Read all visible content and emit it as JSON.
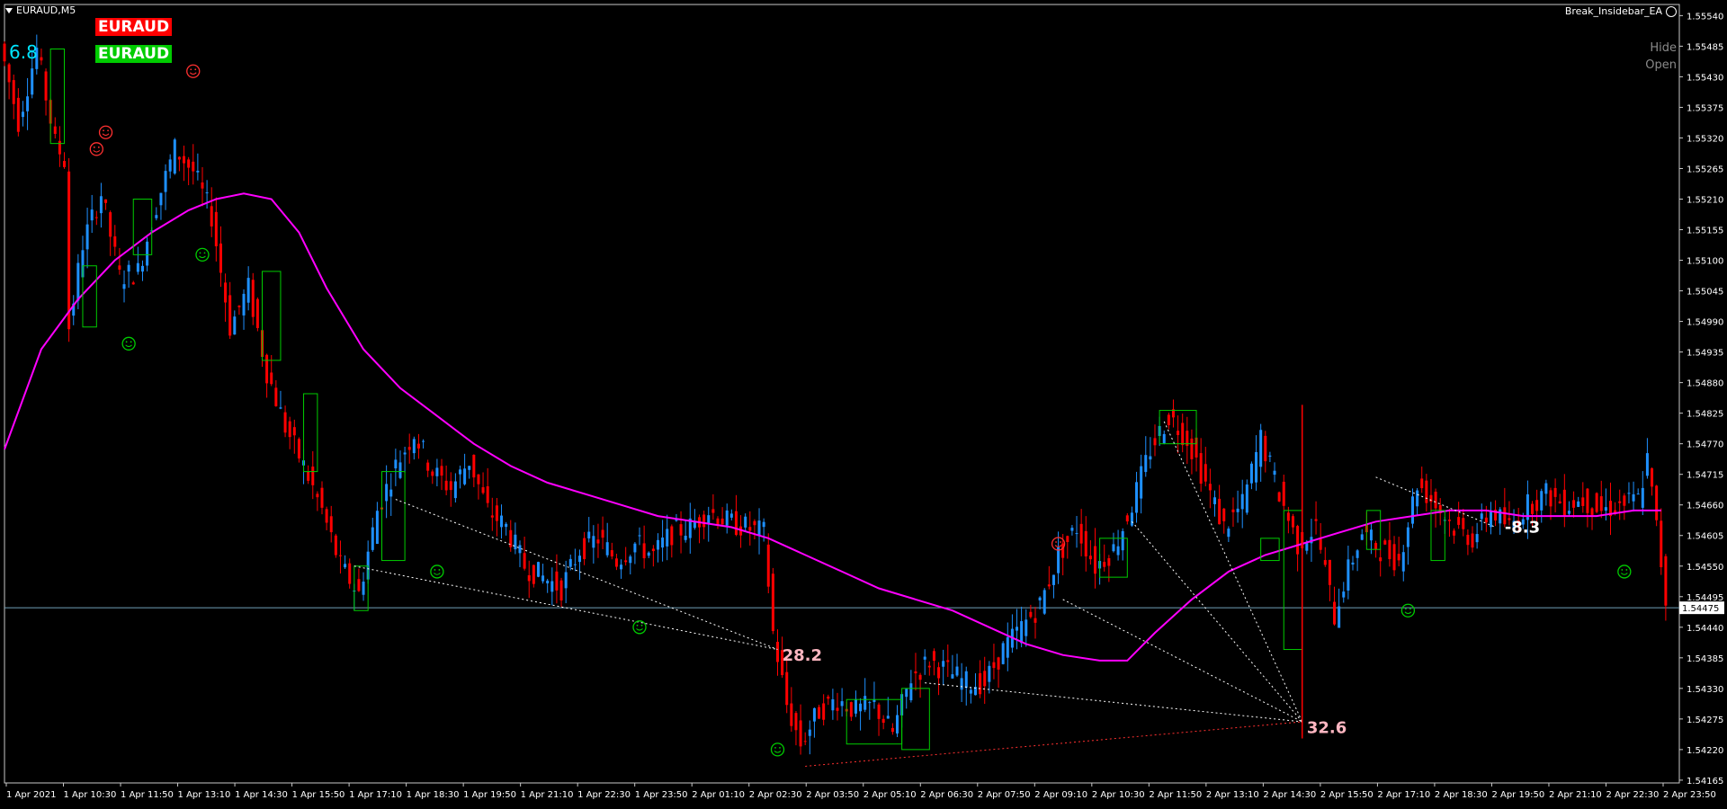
{
  "window": {
    "title": "EURAUD,M5",
    "ea_name": "Break_Insidebar_EA",
    "ea_icon": "smiley-icon"
  },
  "badges": {
    "sell_symbol": "EURAUD",
    "buy_symbol": "EURAUD",
    "sell_color": "#ff0000",
    "buy_color": "#00cc00"
  },
  "score_value": "6.8",
  "panel_buttons": {
    "hide": "Hide",
    "open": "Open"
  },
  "chart_data": {
    "type": "candlestick",
    "symbol": "EURAUD",
    "timeframe": "M5",
    "ylim": [
      1.5416,
      1.5556
    ],
    "y_ticks": [
      "1.55540",
      "1.55485",
      "1.55430",
      "1.55375",
      "1.55320",
      "1.55265",
      "1.55210",
      "1.55155",
      "1.55100",
      "1.55045",
      "1.54990",
      "1.54935",
      "1.54880",
      "1.54825",
      "1.54770",
      "1.54715",
      "1.54660",
      "1.54605",
      "1.54550",
      "1.54495",
      "1.54440",
      "1.54385",
      "1.54330",
      "1.54275",
      "1.54220",
      "1.54165"
    ],
    "x_ticks": [
      "1 Apr 2021",
      "1 Apr 10:30",
      "1 Apr 11:50",
      "1 Apr 13:10",
      "1 Apr 14:30",
      "1 Apr 15:50",
      "1 Apr 17:10",
      "1 Apr 18:30",
      "1 Apr 19:50",
      "1 Apr 21:10",
      "1 Apr 22:30",
      "1 Apr 23:50",
      "2 Apr 01:10",
      "2 Apr 02:30",
      "2 Apr 03:50",
      "2 Apr 05:10",
      "2 Apr 06:30",
      "2 Apr 07:50",
      "2 Apr 09:10",
      "2 Apr 10:30",
      "2 Apr 11:50",
      "2 Apr 13:10",
      "2 Apr 14:30",
      "2 Apr 15:50",
      "2 Apr 17:10",
      "2 Apr 18:30",
      "2 Apr 19:50",
      "2 Apr 21:10",
      "2 Apr 22:30",
      "2 Apr 23:50"
    ],
    "current_price": "1.54475",
    "price_path": [
      [
        0,
        1.5549
      ],
      [
        4,
        1.5535
      ],
      [
        8,
        1.5548
      ],
      [
        12,
        1.5531
      ],
      [
        14,
        1.5528
      ],
      [
        15,
        1.5498
      ],
      [
        18,
        1.5513
      ],
      [
        22,
        1.5522
      ],
      [
        26,
        1.5507
      ],
      [
        30,
        1.5508
      ],
      [
        34,
        1.552
      ],
      [
        38,
        1.553
      ],
      [
        42,
        1.5526
      ],
      [
        46,
        1.5518
      ],
      [
        50,
        1.5498
      ],
      [
        54,
        1.5505
      ],
      [
        58,
        1.549
      ],
      [
        62,
        1.548
      ],
      [
        66,
        1.5473
      ],
      [
        70,
        1.5465
      ],
      [
        74,
        1.5455
      ],
      [
        78,
        1.545
      ],
      [
        82,
        1.5465
      ],
      [
        86,
        1.5473
      ],
      [
        90,
        1.5479
      ],
      [
        94,
        1.5472
      ],
      [
        98,
        1.5469
      ],
      [
        102,
        1.5474
      ],
      [
        106,
        1.5465
      ],
      [
        110,
        1.5462
      ],
      [
        114,
        1.5455
      ],
      [
        118,
        1.5453
      ],
      [
        122,
        1.5451
      ],
      [
        126,
        1.5458
      ],
      [
        130,
        1.546
      ],
      [
        134,
        1.5456
      ],
      [
        138,
        1.5459
      ],
      [
        142,
        1.5457
      ],
      [
        146,
        1.5461
      ],
      [
        150,
        1.5462
      ],
      [
        154,
        1.5465
      ],
      [
        158,
        1.5463
      ],
      [
        162,
        1.5462
      ],
      [
        166,
        1.5461
      ],
      [
        168,
        1.5443
      ],
      [
        171,
        1.543
      ],
      [
        174,
        1.5423
      ],
      [
        178,
        1.5429
      ],
      [
        182,
        1.5431
      ],
      [
        186,
        1.5429
      ],
      [
        190,
        1.543
      ],
      [
        194,
        1.5425
      ],
      [
        198,
        1.5435
      ],
      [
        202,
        1.5438
      ],
      [
        206,
        1.5436
      ],
      [
        210,
        1.5434
      ],
      [
        214,
        1.5434
      ],
      [
        218,
        1.544
      ],
      [
        222,
        1.5444
      ],
      [
        226,
        1.5448
      ],
      [
        230,
        1.5457
      ],
      [
        234,
        1.5462
      ],
      [
        238,
        1.5455
      ],
      [
        242,
        1.5458
      ],
      [
        246,
        1.5466
      ],
      [
        250,
        1.5476
      ],
      [
        254,
        1.5482
      ],
      [
        258,
        1.5478
      ],
      [
        262,
        1.547
      ],
      [
        266,
        1.5462
      ],
      [
        270,
        1.5466
      ],
      [
        274,
        1.5478
      ],
      [
        278,
        1.5468
      ],
      [
        282,
        1.5459
      ],
      [
        286,
        1.5462
      ],
      [
        290,
        1.5446
      ],
      [
        292,
        1.5452
      ],
      [
        296,
        1.5461
      ],
      [
        300,
        1.5458
      ],
      [
        304,
        1.5456
      ],
      [
        308,
        1.547
      ],
      [
        312,
        1.5466
      ],
      [
        316,
        1.5462
      ],
      [
        320,
        1.546
      ],
      [
        324,
        1.5465
      ],
      [
        328,
        1.5462
      ],
      [
        332,
        1.5466
      ],
      [
        336,
        1.5468
      ],
      [
        340,
        1.5466
      ],
      [
        344,
        1.5467
      ],
      [
        348,
        1.5465
      ],
      [
        352,
        1.5466
      ],
      [
        356,
        1.5467
      ],
      [
        358,
        1.5474
      ],
      [
        360,
        1.5462
      ],
      [
        362,
        1.5449
      ]
    ],
    "moving_average": {
      "color": "#ff00ff",
      "points": [
        [
          0,
          1.5476
        ],
        [
          8,
          1.5494
        ],
        [
          16,
          1.5503
        ],
        [
          24,
          1.551
        ],
        [
          32,
          1.5515
        ],
        [
          40,
          1.5519
        ],
        [
          46,
          1.5521
        ],
        [
          52,
          1.5522
        ],
        [
          58,
          1.5521
        ],
        [
          64,
          1.5515
        ],
        [
          70,
          1.5505
        ],
        [
          78,
          1.5494
        ],
        [
          86,
          1.5487
        ],
        [
          94,
          1.5482
        ],
        [
          102,
          1.5477
        ],
        [
          110,
          1.5473
        ],
        [
          118,
          1.547
        ],
        [
          126,
          1.5468
        ],
        [
          134,
          1.5466
        ],
        [
          142,
          1.5464
        ],
        [
          150,
          1.5463
        ],
        [
          158,
          1.5462
        ],
        [
          166,
          1.546
        ],
        [
          174,
          1.5457
        ],
        [
          182,
          1.5454
        ],
        [
          190,
          1.5451
        ],
        [
          198,
          1.5449
        ],
        [
          206,
          1.5447
        ],
        [
          214,
          1.5444
        ],
        [
          222,
          1.5441
        ],
        [
          230,
          1.5439
        ],
        [
          238,
          1.5438
        ],
        [
          244,
          1.5438
        ],
        [
          250,
          1.5443
        ],
        [
          258,
          1.5449
        ],
        [
          266,
          1.5454
        ],
        [
          274,
          1.5457
        ],
        [
          282,
          1.5459
        ],
        [
          290,
          1.5461
        ],
        [
          298,
          1.5463
        ],
        [
          306,
          1.5464
        ],
        [
          314,
          1.5465
        ],
        [
          322,
          1.5465
        ],
        [
          330,
          1.5464
        ],
        [
          338,
          1.5464
        ],
        [
          346,
          1.5464
        ],
        [
          354,
          1.5465
        ],
        [
          360,
          1.5465
        ]
      ]
    },
    "boxes": [
      {
        "color": "#00cc00",
        "x": [
          10,
          13
        ],
        "y": [
          1.5531,
          1.5548
        ]
      },
      {
        "color": "#00cc00",
        "x": [
          17,
          20
        ],
        "y": [
          1.5498,
          1.5509
        ]
      },
      {
        "color": "#00cc00",
        "x": [
          28,
          32
        ],
        "y": [
          1.5511,
          1.5521
        ]
      },
      {
        "color": "#00cc00",
        "x": [
          56,
          60
        ],
        "y": [
          1.5492,
          1.5508
        ]
      },
      {
        "color": "#00cc00",
        "x": [
          65,
          68
        ],
        "y": [
          1.5472,
          1.5486
        ]
      },
      {
        "color": "#00cc00",
        "x": [
          82,
          87
        ],
        "y": [
          1.5456,
          1.5472
        ]
      },
      {
        "color": "#00cc00",
        "x": [
          76,
          79
        ],
        "y": [
          1.5447,
          1.5455
        ]
      },
      {
        "color": "#00cc00",
        "x": [
          183,
          195
        ],
        "y": [
          1.5423,
          1.5431
        ]
      },
      {
        "color": "#00cc00",
        "x": [
          195,
          201
        ],
        "y": [
          1.5422,
          1.5433
        ]
      },
      {
        "color": "#00cc00",
        "x": [
          238,
          244
        ],
        "y": [
          1.5453,
          1.546
        ]
      },
      {
        "color": "#00cc00",
        "x": [
          251,
          259
        ],
        "y": [
          1.5477,
          1.5483
        ]
      },
      {
        "color": "#00cc00",
        "x": [
          273,
          277
        ],
        "y": [
          1.5456,
          1.546
        ]
      },
      {
        "color": "#00cc00",
        "x": [
          278,
          282
        ],
        "y": [
          1.544,
          1.5465
        ]
      },
      {
        "color": "#00cc00",
        "x": [
          296,
          299
        ],
        "y": [
          1.5458,
          1.5465
        ]
      },
      {
        "color": "#00cc00",
        "x": [
          310,
          313
        ],
        "y": [
          1.5456,
          1.5465
        ]
      }
    ],
    "dotted_lines": [
      {
        "color": "#ffffff",
        "from": [
          85,
          1.5467
        ],
        "to": [
          168,
          1.544
        ]
      },
      {
        "color": "#ffffff",
        "from": [
          76,
          1.5455
        ],
        "to": [
          168,
          1.544
        ]
      },
      {
        "color": "#ffffff",
        "from": [
          200,
          1.5434
        ],
        "to": [
          282,
          1.5427
        ]
      },
      {
        "color": "#ffffff",
        "from": [
          230,
          1.5449
        ],
        "to": [
          282,
          1.5427
        ]
      },
      {
        "color": "#ffffff",
        "from": [
          245,
          1.5463
        ],
        "to": [
          282,
          1.5427
        ]
      },
      {
        "color": "#ffffff",
        "from": [
          252,
          1.5481
        ],
        "to": [
          282,
          1.5427
        ]
      },
      {
        "color": "#ffffff",
        "from": [
          298,
          1.5471
        ],
        "to": [
          324,
          1.5462
        ]
      },
      {
        "color": "#ff3030",
        "from": [
          174,
          1.5419
        ],
        "to": [
          282,
          1.5427
        ]
      }
    ],
    "annotations": [
      {
        "text": "28.2",
        "x": 169,
        "y": 1.5438,
        "color": "#ffb6c1"
      },
      {
        "text": "-8.3",
        "x": 326,
        "y": 1.5461,
        "color": "#ffffff"
      },
      {
        "text": "32.6",
        "x": 283,
        "y": 1.5425,
        "color": "#ffb6c1"
      }
    ],
    "smileys": [
      {
        "color": "#ff3030",
        "x": 41,
        "y": 1.5544
      },
      {
        "color": "#ff3030",
        "x": 22,
        "y": 1.5533
      },
      {
        "color": "#ff3030",
        "x": 20,
        "y": 1.553
      },
      {
        "color": "#00cc00",
        "x": 43,
        "y": 1.5511
      },
      {
        "color": "#00cc00",
        "x": 27,
        "y": 1.5495
      },
      {
        "color": "#00cc00",
        "x": 94,
        "y": 1.5454
      },
      {
        "color": "#00cc00",
        "x": 138,
        "y": 1.5444
      },
      {
        "color": "#00cc00",
        "x": 168,
        "y": 1.5422
      },
      {
        "color": "#ff3030",
        "x": 229,
        "y": 1.5459
      },
      {
        "color": "#00cc00",
        "x": 305,
        "y": 1.5447
      },
      {
        "color": "#00cc00",
        "x": 352,
        "y": 1.5454
      }
    ],
    "spike": {
      "color": "#ff0000",
      "x": 282,
      "y": [
        1.5424,
        1.5484
      ]
    }
  }
}
